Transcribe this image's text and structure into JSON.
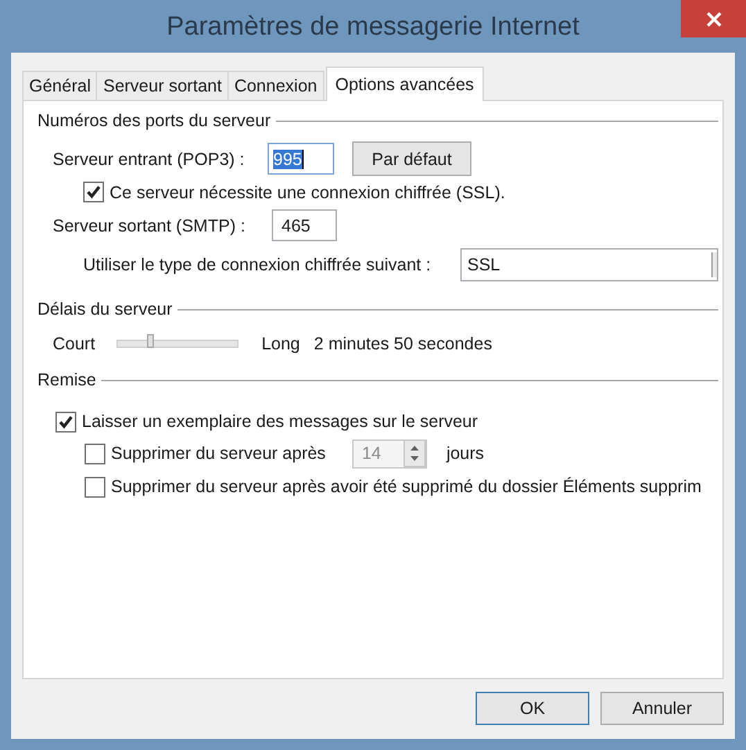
{
  "window": {
    "title": "Paramètres de messagerie Internet"
  },
  "tabs": [
    {
      "label": "Général",
      "selected": false
    },
    {
      "label": "Serveur sortant",
      "selected": false
    },
    {
      "label": "Connexion",
      "selected": false
    },
    {
      "label": "Options avancées",
      "selected": true
    }
  ],
  "ports": {
    "title": "Numéros des ports du serveur",
    "incoming": {
      "label": "Serveur entrant (POP3) :",
      "value": "995",
      "value_selected": true
    },
    "default_button": "Par défaut",
    "ssl_required": {
      "label": "Ce serveur nécessite une connexion chiffrée (SSL).",
      "checked": true
    },
    "outgoing": {
      "label": "Serveur sortant (SMTP) :",
      "value": "465"
    },
    "encryption": {
      "label": "Utiliser le type de connexion chiffrée suivant :",
      "value": "SSL"
    }
  },
  "timeout": {
    "title": "Délais du serveur",
    "min_label": "Court",
    "max_label": "Long",
    "level": 0.28,
    "reading": "2 minutes 50 secondes"
  },
  "delivery": {
    "title": "Remise",
    "options": [
      {
        "kind": "checkbox",
        "label": "Laisser un exemplaire des messages sur le serveur",
        "checked": true,
        "children": [
          {
            "kind": "spinner",
            "label": "Supprimer du serveur après",
            "checked": false,
            "value": "14",
            "unit": "jours",
            "disabled": true
          },
          {
            "kind": "checkbox",
            "label": "Supprimer du serveur après avoir été supprimé du dossier Éléments supprim",
            "checked": false
          }
        ]
      }
    ]
  },
  "buttons": [
    {
      "label": "OK",
      "default": true
    },
    {
      "label": "Annuler",
      "default": false
    }
  ]
}
